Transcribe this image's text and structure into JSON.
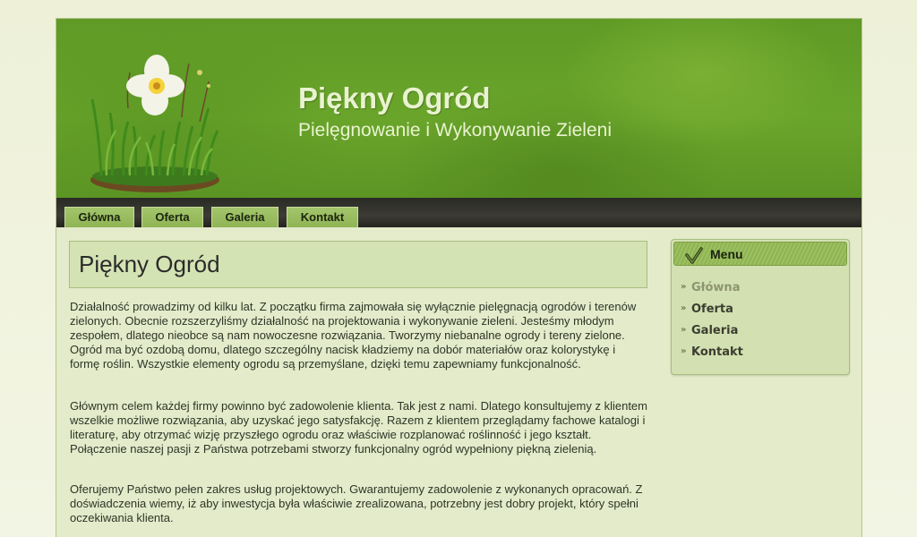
{
  "site": {
    "title": "Piękny Ogród",
    "subtitle": "Pielęgnowanie i Wykonywanie Zieleni"
  },
  "nav": {
    "items": [
      {
        "label": "Główna"
      },
      {
        "label": "Oferta"
      },
      {
        "label": "Galeria"
      },
      {
        "label": "Kontakt"
      }
    ]
  },
  "content": {
    "title": "Piękny Ogród",
    "paragraphs": [
      "Działalność prowadzimy od kilku lat. Z początku firma zajmowała się wyłącznie pielęgnacją ogrodów i terenów zielonych. Obecnie rozszerzyliśmy działalność na projektowania i wykonywanie zieleni. Jesteśmy młodym zespołem, dlatego nieobce są nam nowoczesne rozwiązania. Tworzymy niebanalne ogrody i tereny zielone. Ogród ma być ozdobą domu, dlatego szczególny nacisk kładziemy na dobór materiałów oraz kolorystykę i formę roślin. Wszystkie elementy ogrodu są przemyślane, dzięki temu zapewniamy funkcjonalność.",
      "Głównym celem każdej firmy powinno być zadowolenie klienta. Tak jest z nami. Dlatego konsultujemy z klientem wszelkie możliwe rozwiązania, aby uzyskać jego satysfakcję. Razem z klientem przeglądamy fachowe katalogi i literaturę, aby otrzymać wizję przyszłego ogrodu oraz właściwie rozplanować roślinność i jego kształt. Połączenie naszej pasji z Państwa potrzebami stworzy funkcjonalny ogród wypełniony piękną zielenią.",
      "Oferujemy Państwo pełen zakres usług projektowych. Gwarantujemy zadowolenie z wykonanych opracowań. Z doświadczenia wiemy, iż aby inwestycja była właściwie zrealizowana, potrzebny jest dobry projekt, który spełni oczekiwania klienta."
    ]
  },
  "sidebar": {
    "menu_title": "Menu",
    "items": [
      {
        "label": "Główna",
        "active": true
      },
      {
        "label": "Oferta",
        "active": false
      },
      {
        "label": "Galeria",
        "active": false
      },
      {
        "label": "Kontakt",
        "active": false
      }
    ],
    "bullet": "»"
  },
  "colors": {
    "header_green": "#6aa52b",
    "page_bg": "#e3ebcb",
    "navbar_dark": "#2a2a26",
    "tab_green": "#9bbf63",
    "text": "#2e3526"
  }
}
